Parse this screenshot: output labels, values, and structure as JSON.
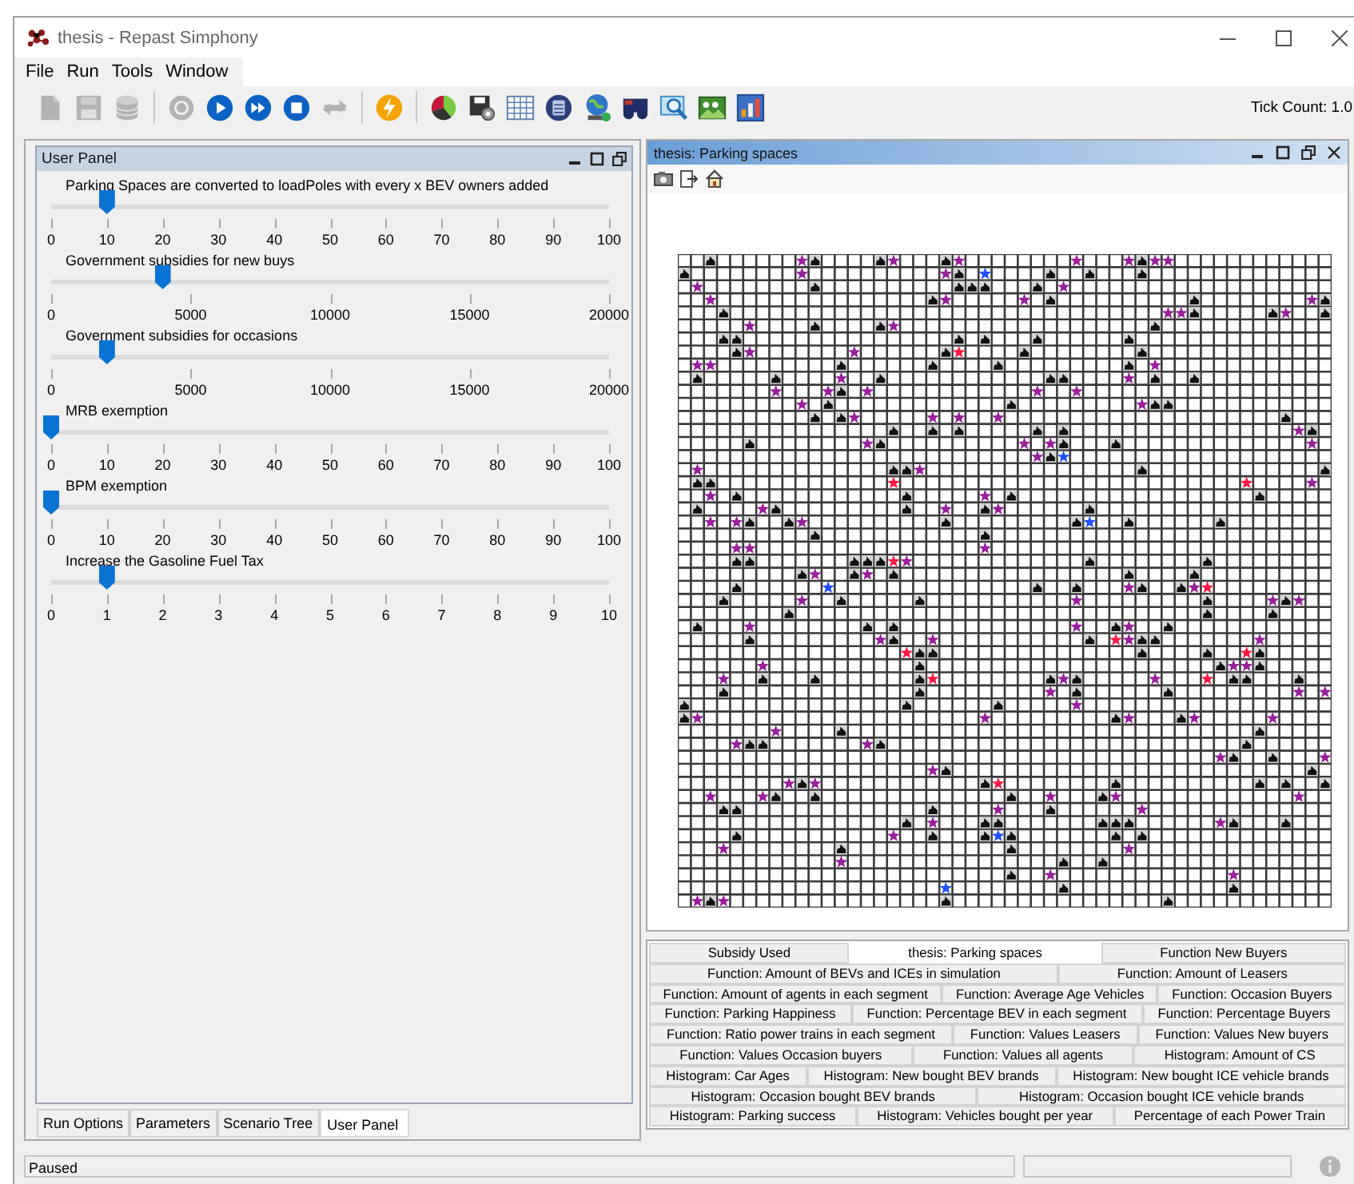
{
  "window": {
    "title": "thesis - Repast Simphony"
  },
  "menu": [
    "File",
    "Run",
    "Tools",
    "Window"
  ],
  "toolbar": [
    {
      "kind": "document",
      "disabled": true
    },
    {
      "kind": "save",
      "disabled": true
    },
    {
      "kind": "database",
      "disabled": true
    },
    {
      "kind": "sep"
    },
    {
      "kind": "power",
      "disabled": true
    },
    {
      "kind": "play",
      "disabled": false
    },
    {
      "kind": "step",
      "disabled": false
    },
    {
      "kind": "stop",
      "disabled": false
    },
    {
      "kind": "repeat",
      "disabled": true
    },
    {
      "kind": "sep"
    },
    {
      "kind": "lightning",
      "disabled": false
    },
    {
      "kind": "sep"
    },
    {
      "kind": "pie",
      "disabled": false
    },
    {
      "kind": "diskgear",
      "disabled": false
    },
    {
      "kind": "table",
      "disabled": false
    },
    {
      "kind": "calculator",
      "disabled": false
    },
    {
      "kind": "globe",
      "disabled": false
    },
    {
      "kind": "binoculars",
      "disabled": false
    },
    {
      "kind": "magnifier",
      "disabled": false
    },
    {
      "kind": "image",
      "disabled": false
    },
    {
      "kind": "chart",
      "disabled": false
    }
  ],
  "tick_count": "Tick Count: 1.0",
  "user_panel": {
    "title": "User Panel",
    "sliders": [
      {
        "label": "Parking Spaces are converted to loadPoles with every x BEV owners added",
        "level": 0.1,
        "ticks": [
          "0",
          "10",
          "20",
          "30",
          "40",
          "50",
          "60",
          "70",
          "80",
          "90",
          "100"
        ]
      },
      {
        "label": "Government subsidies for new buys",
        "level": 0.2,
        "ticks": [
          "0",
          "5000",
          "10000",
          "15000",
          "20000"
        ]
      },
      {
        "label": "Government subsidies for occasions",
        "level": 0.1,
        "ticks": [
          "0",
          "5000",
          "10000",
          "15000",
          "20000"
        ]
      },
      {
        "label": "MRB exemption",
        "level": 0,
        "ticks": [
          "0",
          "10",
          "20",
          "30",
          "40",
          "50",
          "60",
          "70",
          "80",
          "90",
          "100"
        ]
      },
      {
        "label": "BPM exemption",
        "level": 0,
        "ticks": [
          "0",
          "10",
          "20",
          "30",
          "40",
          "50",
          "60",
          "70",
          "80",
          "90",
          "100"
        ]
      },
      {
        "label": "Increase the Gasoline Fuel Tax",
        "level": 0.1,
        "ticks": [
          "0",
          "1",
          "2",
          "3",
          "4",
          "5",
          "6",
          "7",
          "8",
          "9",
          "10"
        ]
      }
    ]
  },
  "left_tabs": [
    {
      "label": "Run Options",
      "selected": false
    },
    {
      "label": "Parameters",
      "selected": false
    },
    {
      "label": "Scenario Tree",
      "selected": false
    },
    {
      "label": "User Panel",
      "selected": true
    }
  ],
  "display": {
    "title": "thesis: Parking spaces"
  },
  "bottom_tabs": [
    [
      {
        "label": "Subsidy Used",
        "selected": false
      },
      {
        "label": "thesis: Parking spaces",
        "selected": true
      },
      {
        "label": "Function New Buyers",
        "selected": false
      }
    ],
    [
      {
        "label": "Function: Amount of BEVs and ICEs in simulation",
        "selected": false
      },
      {
        "label": "Function: Amount of Leasers",
        "selected": false
      }
    ],
    [
      {
        "label": "Function: Amount of agents in each segment",
        "selected": false
      },
      {
        "label": "Function: Average Age Vehicles",
        "selected": false
      },
      {
        "label": "Function: Occasion Buyers",
        "selected": false
      }
    ],
    [
      {
        "label": "Function: Parking Happiness",
        "selected": false
      },
      {
        "label": "Function: Percentage BEV in each segment",
        "selected": false
      },
      {
        "label": "Function: Percentage Buyers",
        "selected": false
      }
    ],
    [
      {
        "label": "Function: Ratio power trains in each segment",
        "selected": false
      },
      {
        "label": "Function: Values Leasers",
        "selected": false
      },
      {
        "label": "Function: Values New buyers",
        "selected": false
      }
    ],
    [
      {
        "label": "Function: Values Occasion buyers",
        "selected": false
      },
      {
        "label": "Function: Values all agents",
        "selected": false
      },
      {
        "label": "Histogram: Amount of CS",
        "selected": false
      }
    ],
    [
      {
        "label": "Histogram: Car Ages",
        "selected": false
      },
      {
        "label": "Histogram: New bought BEV brands",
        "selected": false
      },
      {
        "label": "Histogram: New bought ICE vehicle brands",
        "selected": false
      }
    ],
    [
      {
        "label": "Histogram: Occasion bought BEV brands",
        "selected": false
      },
      {
        "label": "Histogram: Occasion bought ICE vehicle brands",
        "selected": false
      }
    ],
    [
      {
        "label": "Histogram: Parking success",
        "selected": false
      },
      {
        "label": "Histogram: Vehicles bought per year",
        "selected": false
      },
      {
        "label": "Percentage of each Power Train",
        "selected": false
      }
    ]
  ],
  "status_bar": {
    "text": "Paused"
  }
}
